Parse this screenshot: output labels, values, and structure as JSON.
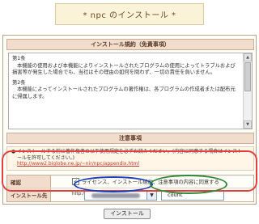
{
  "page_title": "* npc のインストール *",
  "license_section": {
    "header": "インストール規約（免責事項）",
    "clauses": [
      {
        "heading": "第1条",
        "text": "本機能の使用および本機能によりインストールされたプログラムの使用によってトラブルおよび損害等が発生した場合でも、当社はその理由の如何を問わず、一切の責任を負いません。"
      },
      {
        "heading": "第2条",
        "text": "本機能によってインストールされたプログラムの著作権は、各プログラムの作成者または配布元に帰属します。"
      }
    ]
  },
  "notes_section": {
    "header": "注意事項",
    "bullet": "●",
    "text": "インストールする前に著作権者の以下使用規定を必ずお読みください。(内容に同意する場合はインストールを許可してください。)",
    "link": "http://www2.biglobe.ne.jp/~nir/npc/appendix.html"
  },
  "form": {
    "confirm_label": "確認",
    "confirm_checked": true,
    "confirm_text": "ライセンス、インストール規約、注意事項の内容に同意する",
    "install_to_label": "インストール先",
    "url_prefix": "http://",
    "directory_value": "count"
  },
  "install_button": "インストール",
  "colors": {
    "annotation_red": "#e2403f",
    "annotation_blue": "#1a3fbd",
    "annotation_green": "#2f8a3a"
  }
}
